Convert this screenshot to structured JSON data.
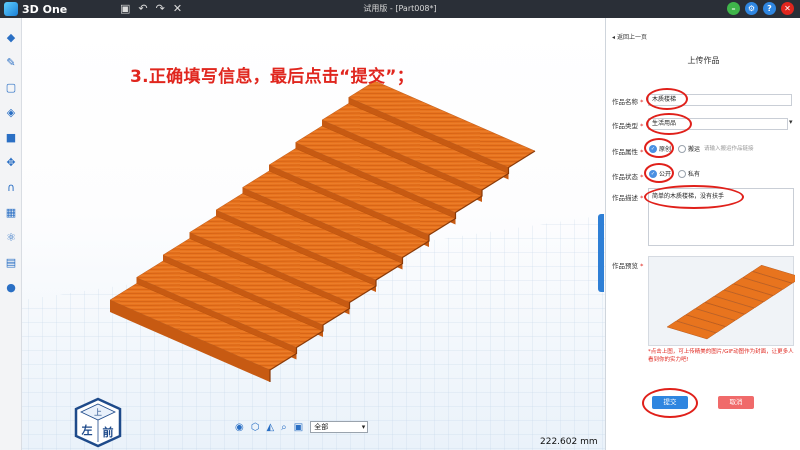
{
  "app": {
    "brand": "3D One",
    "window_title": "试用版 - [Part008*]",
    "title_tools": [
      "save-icon",
      "undo-icon",
      "redo-icon",
      "close-icon"
    ],
    "window_controls": [
      "minimize-icon",
      "settings-icon",
      "help-icon",
      "close-icon"
    ]
  },
  "left_toolbar": [
    "draw-icon",
    "sketch-icon",
    "face-icon",
    "combine-icon",
    "cube-icon",
    "move-icon",
    "magnet-icon",
    "pattern-icon",
    "measure-icon",
    "layer-icon",
    "color-icon"
  ],
  "viewport": {
    "instruction": "3.正确填写信息，最后点击“提交”；",
    "view_cube": {
      "top": "上",
      "left": "左",
      "front": "前"
    },
    "bottom_tools": [
      "eye-icon",
      "view-cube-icon",
      "render-icon",
      "zoom-icon",
      "filter-icon"
    ],
    "filter_select": "全部",
    "unit_readout": "222.602 mm"
  },
  "panel": {
    "back_label": "返回上一页",
    "title": "上传作品",
    "fields": {
      "name_label": "作品名称",
      "name_value": "木质楼梯",
      "type_label": "作品类型",
      "type_value": "生活用品",
      "attr_label": "作品属性",
      "attr_option_1": "原创",
      "attr_option_2": "搬运",
      "attr_link_placeholder": "请输入搬运作品链接",
      "status_label": "作品状态",
      "status_option_1": "公开",
      "status_option_2": "私有",
      "desc_label": "作品描述",
      "desc_value": "简单的木质楼梯，没有扶手",
      "preview_label": "作品预览"
    },
    "hint": "*点击上图，可上传精美的图片/GIF动图作为封面，让更多人看到你的实力吧!",
    "submit_label": "提交",
    "cancel_label": "取消",
    "required_mark": "*"
  },
  "colors": {
    "accent": "#2f86e0",
    "annotation_red": "#e0201a",
    "stair_wood": "#e8741e",
    "titlebar": "#2a2f37"
  }
}
